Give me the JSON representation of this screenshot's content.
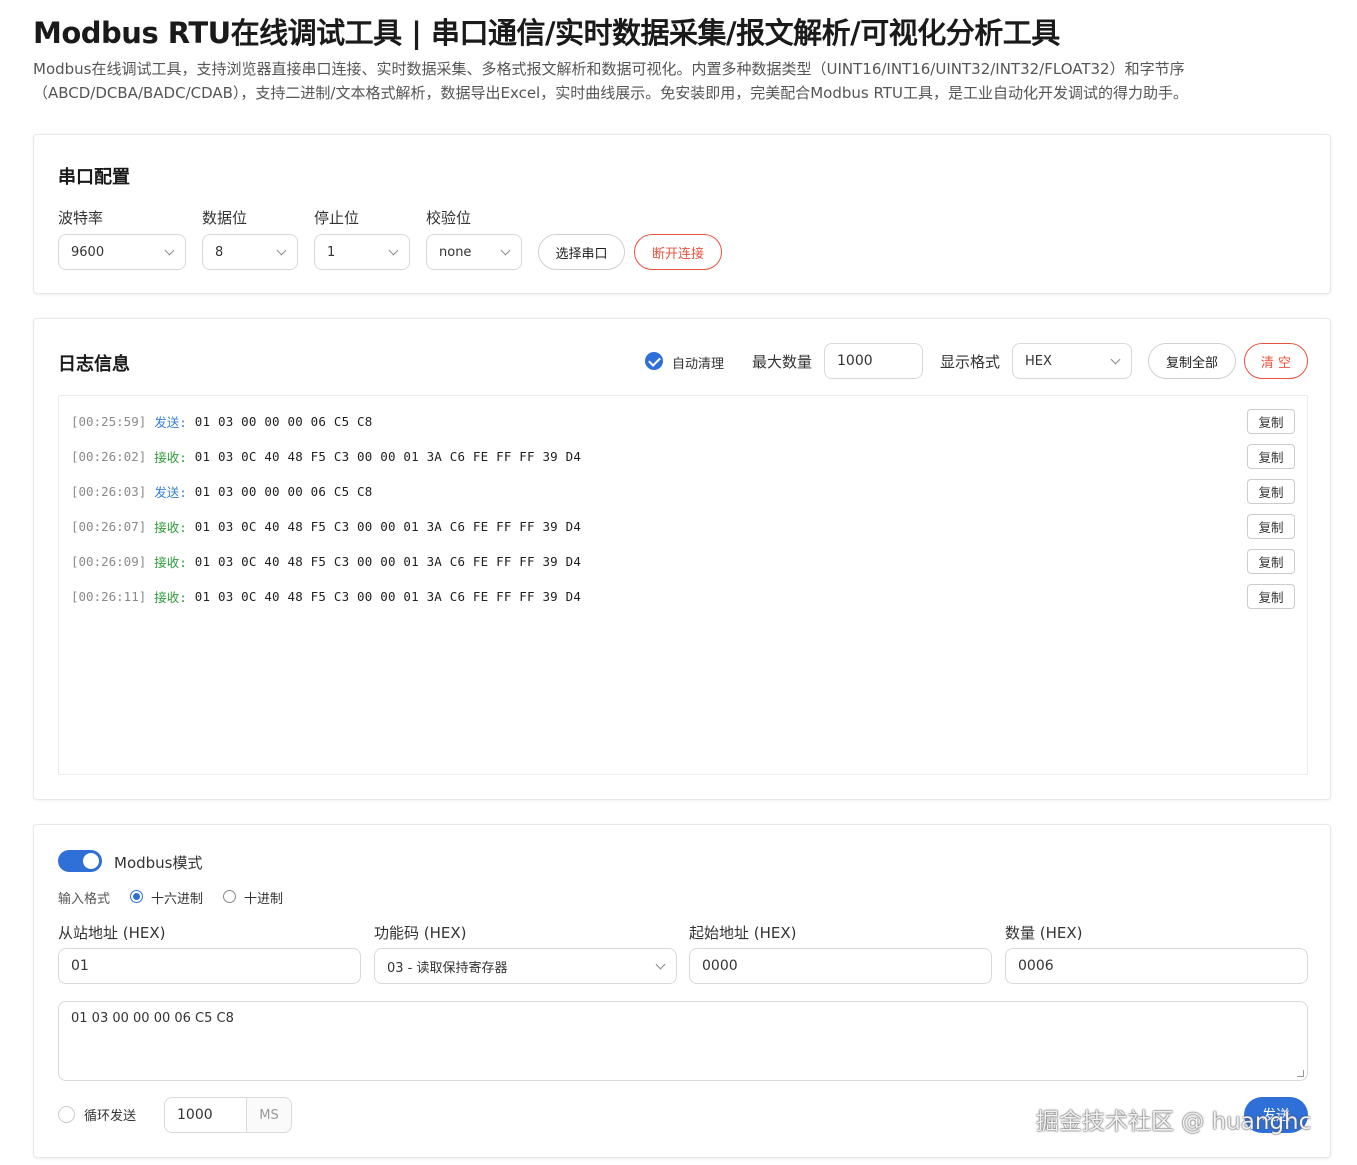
{
  "page": {
    "title": "Modbus RTU在线调试工具 | 串口通信/实时数据采集/报文解析/可视化分析工具",
    "description": "Modbus在线调试工具，支持浏览器直接串口连接、实时数据采集、多格式报文解析和数据可视化。内置多种数据类型（UINT16/INT16/UINT32/INT32/FLOAT32）和字节序（ABCD/DCBA/BADC/CDAB），支持二进制/文本格式解析，数据导出Excel，实时曲线展示。免安装即用，完美配合Modbus RTU工具，是工业自动化开发调试的得力助手。"
  },
  "serial": {
    "title": "串口配置",
    "baud_label": "波特率",
    "baud_value": "9600",
    "databits_label": "数据位",
    "databits_value": "8",
    "stopbits_label": "停止位",
    "stopbits_value": "1",
    "parity_label": "校验位",
    "parity_value": "none",
    "select_port_label": "选择串口",
    "disconnect_label": "断开连接"
  },
  "log": {
    "title": "日志信息",
    "auto_clear_label": "自动清理",
    "max_count_label": "最大数量",
    "max_count_value": "1000",
    "format_label": "显示格式",
    "format_value": "HEX",
    "copy_all_label": "复制全部",
    "clear_label": "清 空",
    "copy_label": "复制",
    "entries": [
      {
        "time": "[00:25:59]",
        "dir": "发送:",
        "type": "send",
        "data": "01 03 00 00 00 06 C5 C8"
      },
      {
        "time": "[00:26:02]",
        "dir": "接收:",
        "type": "recv",
        "data": "01 03 0C 40 48 F5 C3 00 00 01 3A C6 FE FF FF 39 D4"
      },
      {
        "time": "[00:26:03]",
        "dir": "发送:",
        "type": "send",
        "data": "01 03 00 00 00 06 C5 C8"
      },
      {
        "time": "[00:26:07]",
        "dir": "接收:",
        "type": "recv",
        "data": "01 03 0C 40 48 F5 C3 00 00 01 3A C6 FE FF FF 39 D4"
      },
      {
        "time": "[00:26:09]",
        "dir": "接收:",
        "type": "recv",
        "data": "01 03 0C 40 48 F5 C3 00 00 01 3A C6 FE FF FF 39 D4"
      },
      {
        "time": "[00:26:11]",
        "dir": "接收:",
        "type": "recv",
        "data": "01 03 0C 40 48 F5 C3 00 00 01 3A C6 FE FF FF 39 D4"
      }
    ]
  },
  "modbus": {
    "mode_label": "Modbus模式",
    "input_format_label": "输入格式",
    "hex_label": "十六进制",
    "dec_label": "十进制",
    "slave_label": "从站地址 (HEX)",
    "slave_value": "01",
    "func_label": "功能码 (HEX)",
    "func_value": "03 - 读取保持寄存器",
    "start_label": "起始地址 (HEX)",
    "start_value": "0000",
    "qty_label": "数量 (HEX)",
    "qty_value": "0006",
    "frame": "01 03 00 00 00 06 C5 C8",
    "loop_label": "循环发送",
    "interval_value": "1000",
    "interval_unit": "MS",
    "send_label": "发送"
  },
  "watermark": "掘金技术社区 @ huanghc",
  "colors": {
    "accent": "#2f6fd8",
    "danger": "#e8533f",
    "send": "#3a7fd5",
    "recv": "#2e9d3a"
  }
}
